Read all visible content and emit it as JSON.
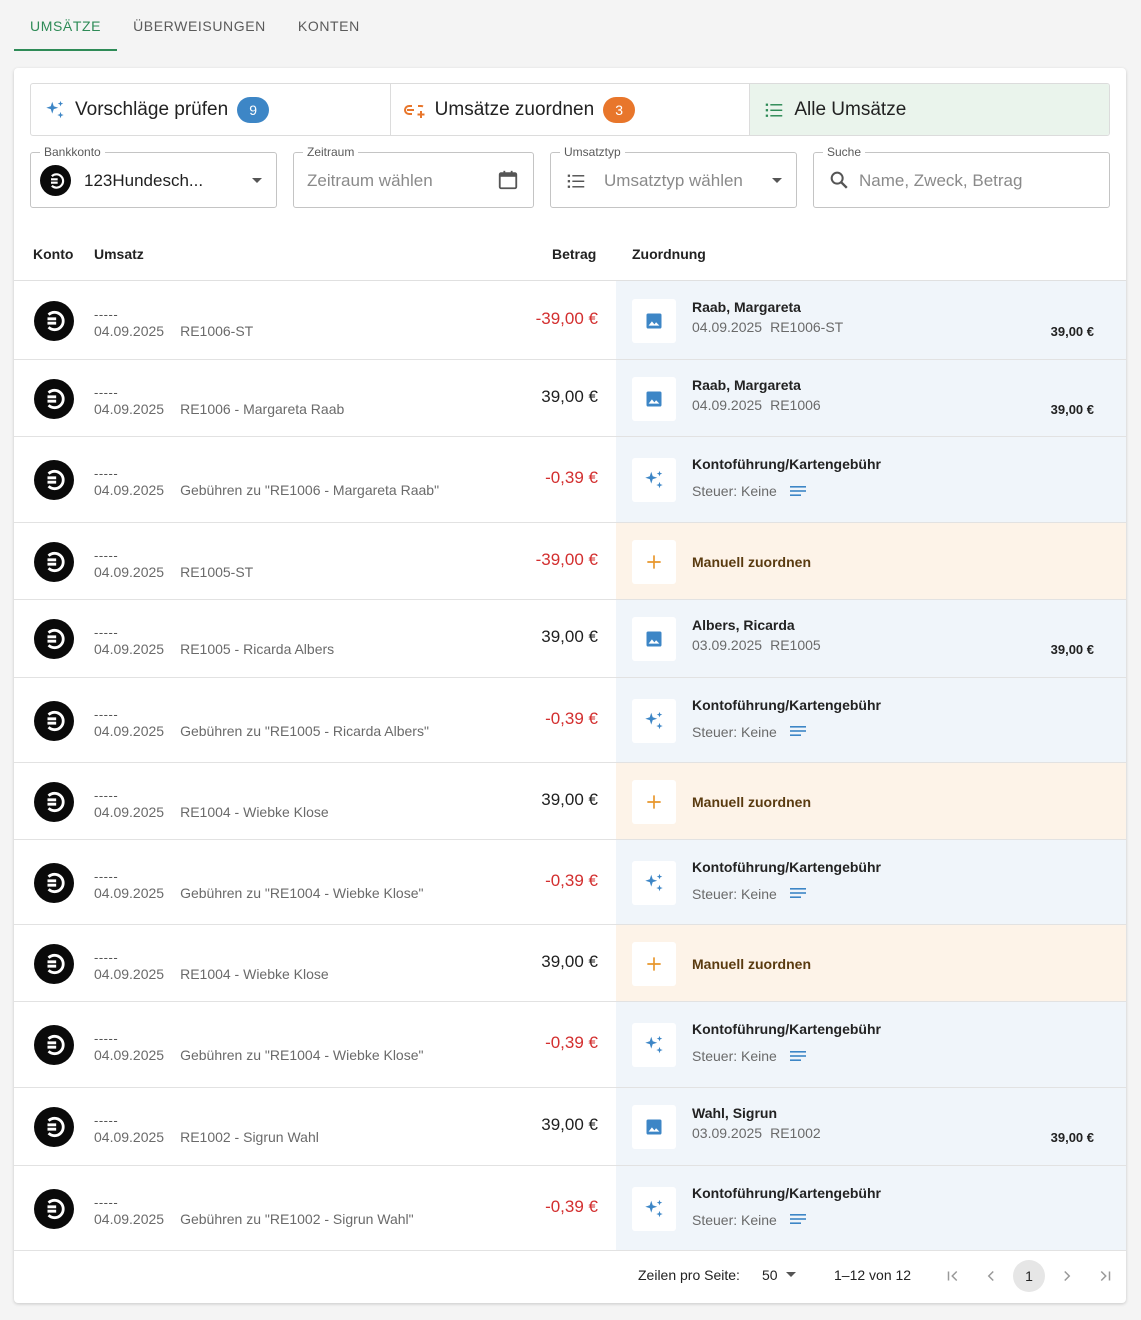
{
  "tabs": [
    {
      "label": "UMSÄTZE",
      "active": true
    },
    {
      "label": "ÜBERWEISUNGEN",
      "active": false
    },
    {
      "label": "KONTEN",
      "active": false
    }
  ],
  "segments": [
    {
      "label": "Vorschläge prüfen",
      "badge": "9",
      "badge_color": "#3d86c6",
      "icon": "sparkles-icon"
    },
    {
      "label": "Umsätze zuordnen",
      "badge": "3",
      "badge_color": "#e8762b",
      "icon": "link-add-icon"
    },
    {
      "label": "Alle Umsätze",
      "badge": "",
      "icon": "list-icon"
    }
  ],
  "filters": {
    "bank": {
      "label": "Bankkonto",
      "value": "123Hundesch..."
    },
    "period": {
      "label": "Zeitraum",
      "placeholder": "Zeitraum wählen"
    },
    "type": {
      "label": "Umsatztyp",
      "placeholder": "Umsatztyp wählen"
    },
    "search": {
      "label": "Suche",
      "placeholder": "Name, Zweck, Betrag"
    }
  },
  "columns": {
    "account": "Konto",
    "transaction": "Umsatz",
    "amount": "Betrag",
    "assignment": "Zuordnung"
  },
  "rows": [
    {
      "title": "-----",
      "date": "04.09.2025",
      "purpose": "RE1006-ST",
      "amount": "-39,00 €",
      "negative": true,
      "assign": {
        "kind": "document",
        "name": "Raab, Margareta",
        "date": "04.09.2025",
        "ref": "RE1006-ST",
        "amount": "39,00 €"
      }
    },
    {
      "title": "-----",
      "date": "04.09.2025",
      "purpose": "RE1006 - Margareta Raab",
      "amount": "39,00 €",
      "negative": false,
      "assign": {
        "kind": "document",
        "name": "Raab, Margareta",
        "date": "04.09.2025",
        "ref": "RE1006",
        "amount": "39,00 €"
      }
    },
    {
      "title": "-----",
      "date": "04.09.2025",
      "purpose": "Gebühren zu \"RE1006 - Margareta Raab\"",
      "amount": "-0,39 €",
      "negative": true,
      "assign": {
        "kind": "suggestion",
        "name": "Kontoführung/Kartengebühr",
        "tax": "Steuer: Keine"
      }
    },
    {
      "title": "-----",
      "date": "04.09.2025",
      "purpose": "RE1005-ST",
      "amount": "-39,00 €",
      "negative": true,
      "assign": {
        "kind": "manual",
        "label": "Manuell zuordnen"
      }
    },
    {
      "title": "-----",
      "date": "04.09.2025",
      "purpose": "RE1005 - Ricarda Albers",
      "amount": "39,00 €",
      "negative": false,
      "assign": {
        "kind": "document",
        "name": "Albers, Ricarda",
        "date": "03.09.2025",
        "ref": "RE1005",
        "amount": "39,00 €"
      }
    },
    {
      "title": "-----",
      "date": "04.09.2025",
      "purpose": "Gebühren zu \"RE1005 - Ricarda Albers\"",
      "amount": "-0,39 €",
      "negative": true,
      "assign": {
        "kind": "suggestion",
        "name": "Kontoführung/Kartengebühr",
        "tax": "Steuer: Keine"
      }
    },
    {
      "title": "-----",
      "date": "04.09.2025",
      "purpose": "RE1004 - Wiebke Klose",
      "amount": "39,00 €",
      "negative": false,
      "assign": {
        "kind": "manual",
        "label": "Manuell zuordnen"
      }
    },
    {
      "title": "-----",
      "date": "04.09.2025",
      "purpose": "Gebühren zu \"RE1004 - Wiebke Klose\"",
      "amount": "-0,39 €",
      "negative": true,
      "assign": {
        "kind": "suggestion",
        "name": "Kontoführung/Kartengebühr",
        "tax": "Steuer: Keine"
      }
    },
    {
      "title": "-----",
      "date": "04.09.2025",
      "purpose": "RE1004 - Wiebke Klose",
      "amount": "39,00 €",
      "negative": false,
      "assign": {
        "kind": "manual",
        "label": "Manuell zuordnen"
      }
    },
    {
      "title": "-----",
      "date": "04.09.2025",
      "purpose": "Gebühren zu \"RE1004 - Wiebke Klose\"",
      "amount": "-0,39 €",
      "negative": true,
      "assign": {
        "kind": "suggestion",
        "name": "Kontoführung/Kartengebühr",
        "tax": "Steuer: Keine"
      }
    },
    {
      "title": "-----",
      "date": "04.09.2025",
      "purpose": "RE1002 - Sigrun Wahl",
      "amount": "39,00 €",
      "negative": false,
      "assign": {
        "kind": "document",
        "name": "Wahl, Sigrun",
        "date": "03.09.2025",
        "ref": "RE1002",
        "amount": "39,00 €"
      }
    },
    {
      "title": "-----",
      "date": "04.09.2025",
      "purpose": "Gebühren zu \"RE1002 - Sigrun Wahl\"",
      "amount": "-0,39 €",
      "negative": true,
      "assign": {
        "kind": "suggestion",
        "name": "Kontoführung/Kartengebühr",
        "tax": "Steuer: Keine"
      }
    }
  ],
  "pagination": {
    "rows_label": "Zeilen pro Seite:",
    "rows_per_page": "50",
    "range": "1–12 von 12",
    "page": "1"
  },
  "colors": {
    "accent": "#2e8b57",
    "negative": "#d32f2f",
    "icon_blue": "#3d86c6",
    "orange": "#e8962b"
  }
}
